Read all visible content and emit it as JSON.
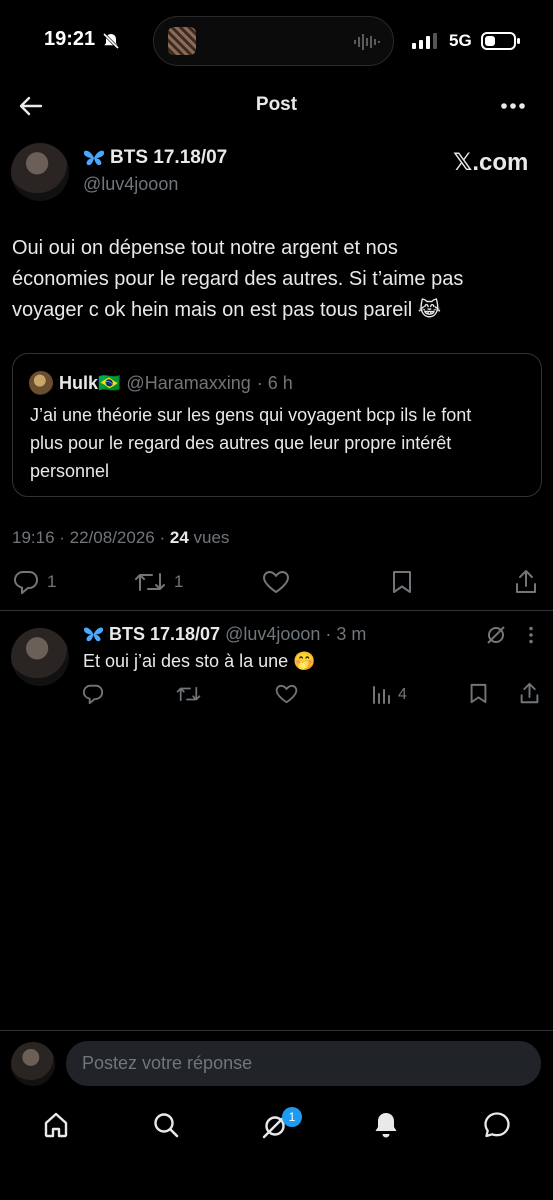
{
  "status_bar": {
    "time": "19:21",
    "network": "5G"
  },
  "header": {
    "title": "Post"
  },
  "post": {
    "author_name": "BTS 17.18/07",
    "handle": "@luv4jooon",
    "source": "𝕏.com",
    "text_lines": [
      "Oui oui on dépense tout notre argent et nos",
      "économies pour le regard des autres. Si t’aime pas",
      "voyager c ok hein mais on est pas tous pareil 😹"
    ],
    "quote": {
      "name": "Hulk🇧🇷",
      "handle": "@Haramaxxing",
      "time": "· 6 h",
      "text_lines": [
        "J’ai une théorie sur les gens qui voyagent bcp ils le font",
        "plus pour le regard des autres que leur propre intérêt",
        "personnel"
      ]
    },
    "timestamp": "19:16 · 22/08/2026 ·",
    "views_count": "24",
    "views_label": "vues",
    "actions": {
      "replies": "1",
      "reposts": "1"
    }
  },
  "reply": {
    "author_name": "BTS 17.18/07",
    "handle": "@luv4jooon",
    "time": "· 3 m",
    "text": "Et oui j’ai des sto à la une 🤭",
    "views": "4"
  },
  "composer": {
    "placeholder": "Postez votre réponse"
  },
  "bottom_nav": {
    "notifications_badge": "1"
  },
  "colors": {
    "accent": "#1d9bf0",
    "background": "#000000",
    "muted": "#71767b",
    "text": "#e7e9ea"
  }
}
